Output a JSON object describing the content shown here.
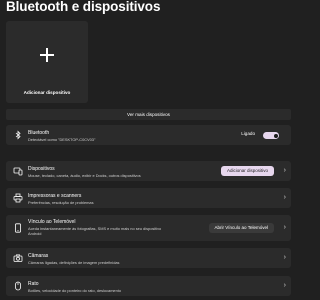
{
  "page": {
    "title": "Bluetooth e dispositivos"
  },
  "add_card": {
    "label": "Adicionar dispositivo",
    "icon": "plus-icon"
  },
  "more_devices": {
    "label": "Ver mais dispositivos"
  },
  "bluetooth": {
    "title": "Bluetooth",
    "subtitle": "Detectável como \"DESKTOP-C0CV03\"",
    "toggle_label": "Ligado",
    "toggle_on": true,
    "icon": "bluetooth-icon"
  },
  "rows": {
    "devices": {
      "title": "Dispositivos",
      "subtitle": "Mouse, teclado, caneta, áudio, exibir e Docks, outros dispositivos",
      "button": "Adicionar dispositivo",
      "icon": "devices-icon"
    },
    "printers": {
      "title": "Impressoras e scanners",
      "subtitle": "Preferências, resolução de problemas",
      "icon": "printer-icon"
    },
    "phone_link": {
      "title": "Vínculo ao Telemóvel",
      "subtitle_line1": "Aceda instantaneamente às fotografias, SMS e muito mais no seu dispositivo",
      "subtitle_line2": "Android",
      "button": "Abrir Vínculo ao Telemóvel",
      "icon": "phone-icon"
    },
    "cameras": {
      "title": "Câmaras",
      "subtitle": "Câmaras ligadas, definições de imagem predefinidas",
      "icon": "camera-icon"
    },
    "mouse": {
      "title": "Rato",
      "subtitle": "Botões, velocidade do ponteiro do rato, deslocamento",
      "icon": "mouse-icon"
    }
  },
  "colors": {
    "background": "#202020",
    "card": "#2b2b2b",
    "accent": "#e7d7ee"
  }
}
